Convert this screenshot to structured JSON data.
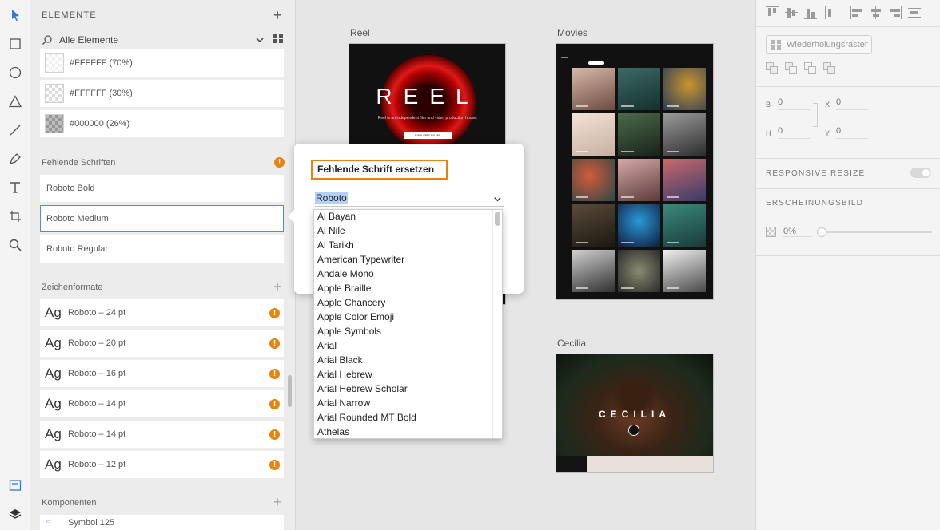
{
  "toolbar": {
    "tools": [
      "select-icon",
      "rectangle-icon",
      "ellipse-icon",
      "triangle-icon",
      "line-icon",
      "pen-icon",
      "text-icon",
      "artboard-icon",
      "zoom-icon"
    ],
    "bottom": [
      "assets-icon",
      "layers-icon"
    ]
  },
  "assets": {
    "title": "ELEMENTE",
    "search_value": "Alle Elemente",
    "colors": [
      {
        "label": "#FFFFFF (70%)",
        "hex": "#FFFFFF",
        "alpha": 0.7
      },
      {
        "label": "#FFFFFF (30%)",
        "hex": "#FFFFFF",
        "alpha": 0.3
      },
      {
        "label": "#000000 (26%)",
        "hex": "#000000",
        "alpha": 0.26
      }
    ],
    "missing_fonts_title": "Fehlende Schriften",
    "missing_fonts": [
      "Roboto Bold",
      "Roboto Medium",
      "Roboto Regular"
    ],
    "char_styles_title": "Zeichenformate",
    "char_styles": [
      {
        "sample": "Ag",
        "label": "Roboto – 24 pt"
      },
      {
        "sample": "Ag",
        "label": "Roboto – 20 pt"
      },
      {
        "sample": "Ag",
        "label": "Roboto – 16 pt"
      },
      {
        "sample": "Ag",
        "label": "Roboto – 14 pt"
      },
      {
        "sample": "Ag",
        "label": "Roboto – 14 pt"
      },
      {
        "sample": "Ag",
        "label": "Roboto – 12 pt"
      }
    ],
    "components_title": "Komponenten",
    "components": [
      "Symbol 125"
    ],
    "warning_glyph": "!"
  },
  "canvas": {
    "artboards": {
      "reel": {
        "label": "Reel",
        "title": "REEL",
        "subtitle": "Reel is an independent film and video production house.",
        "button": "EXPLORE FILMS"
      },
      "movies": {
        "label": "Movies"
      },
      "cecilia": {
        "label": "Cecilia",
        "title": "CECILIA"
      }
    }
  },
  "dialog": {
    "title": "Fehlende Schrift ersetzen",
    "selected_font": "Roboto",
    "font_options": [
      "Al Bayan",
      "Al Nile",
      "Al Tarikh",
      "American Typewriter",
      "Andale Mono",
      "Apple Braille",
      "Apple Chancery",
      "Apple Color Emoji",
      "Apple Symbols",
      "Arial",
      "Arial Black",
      "Arial Hebrew",
      "Arial Hebrew Scholar",
      "Arial Narrow",
      "Arial Rounded MT Bold",
      "Athelas"
    ]
  },
  "properties": {
    "repeat_grid": "Wiederholungsraster",
    "b_label": "B",
    "b_value": "0",
    "x_label": "X",
    "x_value": "0",
    "h_label": "H",
    "h_value": "0",
    "y_label": "Y",
    "y_value": "0",
    "responsive_resize": "RESPONSIVE RESIZE",
    "appearance": "ERSCHEINUNGSBILD",
    "opacity": "0%"
  },
  "colors": {
    "accent": "#e8830f",
    "focus": "#4a90d9",
    "selection": "#b3d1f2"
  }
}
